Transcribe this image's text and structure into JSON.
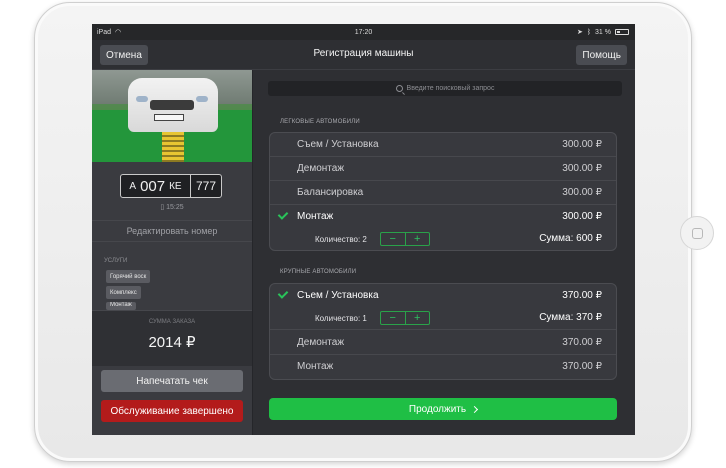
{
  "status_bar": {
    "device": "iPad",
    "time": "17:20",
    "battery": "31 %"
  },
  "nav": {
    "cancel_label": "Отмена",
    "title": "Регистрация машины",
    "help_label": "Помощь"
  },
  "vehicle": {
    "plate_letter1": "А",
    "plate_number": "007",
    "plate_letters2": "КЕ",
    "plate_region": "777",
    "time": "15:25",
    "edit_label": "Редактировать номер"
  },
  "services_panel": {
    "title": "Услуги",
    "tags": [
      "Горячий воск",
      "Комплекс",
      "Монтаж"
    ],
    "total_label": "Сумма заказа",
    "total_value": "2014 ₽",
    "print_label": "Напечатать чек",
    "done_label": "Обслуживание завершено"
  },
  "search": {
    "placeholder": "Введите поисковый запрос"
  },
  "sections": [
    {
      "title": "Легковые автомобили",
      "rows": [
        {
          "name": "Съем / Установка",
          "price": "300.00 ₽",
          "selected": false
        },
        {
          "name": "Демонтаж",
          "price": "300.00 ₽",
          "selected": false
        },
        {
          "name": "Балансировка",
          "price": "300.00 ₽",
          "selected": false
        },
        {
          "name": "Монтаж",
          "price": "300.00 ₽",
          "selected": true
        }
      ],
      "quantity_label": "Количество: 2",
      "sum_label": "Сумма: 600 ₽"
    },
    {
      "title": "Крупные автомобили",
      "rows": [
        {
          "name": "Съем / Установка",
          "price": "370.00 ₽",
          "selected": true
        },
        {
          "name": "Демонтаж",
          "price": "370.00 ₽",
          "selected": false
        },
        {
          "name": "Монтаж",
          "price": "370.00 ₽",
          "selected": false
        }
      ],
      "quantity_label": "Количество: 1",
      "sum_label": "Сумма: 370 ₽"
    }
  ],
  "stepper": {
    "minus": "−",
    "plus": "+"
  },
  "continue_label": "Продолжить",
  "colors": {
    "accent_green": "#1fbf45",
    "danger_red": "#b31b1b",
    "background": "#2e2f33"
  }
}
